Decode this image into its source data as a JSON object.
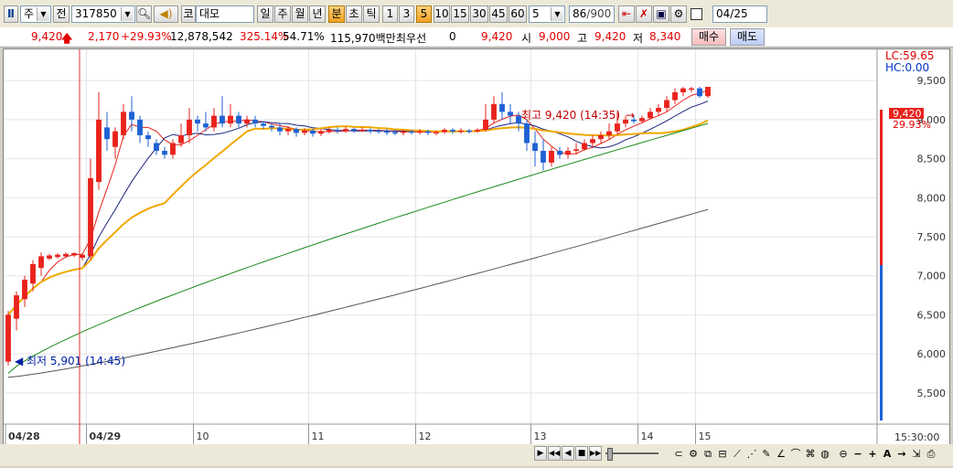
{
  "toolbar": {
    "market_label": "주",
    "prefix_label": "전",
    "code_value": "317850",
    "market_tag": "코",
    "stock_name": "대모",
    "period_buttons": [
      "일",
      "주",
      "월",
      "년",
      "분",
      "초",
      "틱"
    ],
    "active_period": "분",
    "interval_buttons": [
      "1",
      "3",
      "5",
      "10",
      "15",
      "30",
      "45",
      "60"
    ],
    "active_interval": "5",
    "interval_select": "5",
    "count_value": "86",
    "count_total": "/900",
    "date_value": "04/25"
  },
  "quote": {
    "price": "9,420",
    "change": "2,170",
    "change_pct": "+29.93%",
    "volume": "12,878,542",
    "volume_ratio": "325.14%",
    "turnover_ratio": "54.71%",
    "amount": "115,970백만",
    "priority_label": "최우선",
    "priority_qty": "0",
    "priority_price": "9,420",
    "open_label": "시",
    "open_value": "9,000",
    "high_label": "고",
    "high_value": "9,420",
    "low_label": "저",
    "low_value": "8,340",
    "buy_label": "매수",
    "sell_label": "매도"
  },
  "chart": {
    "lc_label": "LC:59.65",
    "hc_label": "HC:0.00",
    "current_price_tag": "9,420",
    "current_pct_tag": "29.93%",
    "high_annotation": "최고 9,420 (14:35)",
    "low_annotation": "최저 5,901 (14:45)",
    "time_label": "15:30:00",
    "date_labels": [
      "04/28",
      "04/29",
      "10",
      "11",
      "12",
      "13",
      "14",
      "15"
    ],
    "colors": {
      "up": "#e8231c",
      "down": "#1f62d4",
      "ma5": "#e8231c",
      "ma10": "#1a237e",
      "ma20": "#f0a800",
      "ma60": "#1a8a1a",
      "ma120": "#555555"
    }
  },
  "chart_data": {
    "type": "candlestick",
    "ylim": [
      5100,
      9900
    ],
    "y_ticks": [
      "9,500",
      "9,000",
      "8,500",
      "8,000",
      "7,500",
      "7,000",
      "6,500",
      "6,000",
      "5,500"
    ],
    "y_tick_values": [
      9500,
      9000,
      8500,
      8000,
      7500,
      7000,
      6500,
      6000,
      5500
    ],
    "x_labels": [
      "04/28",
      "04/29",
      "10",
      "11",
      "12",
      "13",
      "14",
      "15"
    ],
    "candles": [
      [
        5900,
        6500,
        5850,
        6550
      ],
      [
        6450,
        6750,
        6300,
        6800
      ],
      [
        6700,
        6950,
        6600,
        7000
      ],
      [
        6900,
        7150,
        6800,
        7200
      ],
      [
        7100,
        7250,
        7000,
        7300
      ],
      [
        7220,
        7260,
        7200,
        7280
      ],
      [
        7240,
        7270,
        7220,
        7290
      ],
      [
        7250,
        7280,
        7230,
        7300
      ],
      [
        7260,
        7290,
        7240,
        7300
      ],
      [
        7230,
        7270,
        7200,
        7290
      ],
      [
        7250,
        8250,
        7200,
        8500
      ],
      [
        8200,
        9000,
        8100,
        9350
      ],
      [
        8900,
        8750,
        8600,
        9100
      ],
      [
        8650,
        8850,
        8500,
        8900
      ],
      [
        8800,
        9100,
        8750,
        9200
      ],
      [
        9100,
        9000,
        8850,
        9300
      ],
      [
        9000,
        8800,
        8700,
        9050
      ],
      [
        8800,
        8750,
        8650,
        8850
      ],
      [
        8700,
        8600,
        8550,
        8750
      ],
      [
        8600,
        8550,
        8500,
        8650
      ],
      [
        8550,
        8700,
        8500,
        8750
      ],
      [
        8700,
        8800,
        8650,
        8950
      ],
      [
        8800,
        9000,
        8700,
        9150
      ],
      [
        9000,
        8950,
        8850,
        9050
      ],
      [
        8950,
        8900,
        8850,
        9100
      ],
      [
        8900,
        9050,
        8850,
        9150
      ],
      [
        9050,
        8950,
        8900,
        9300
      ],
      [
        8950,
        9050,
        8900,
        9200
      ],
      [
        9050,
        8950,
        8900,
        9100
      ],
      [
        8950,
        9000,
        8900,
        9050
      ],
      [
        9000,
        8950,
        8900,
        9050
      ],
      [
        8950,
        8920,
        8880,
        8980
      ],
      [
        8920,
        8900,
        8850,
        8950
      ],
      [
        8900,
        8850,
        8800,
        8950
      ],
      [
        8850,
        8880,
        8800,
        8920
      ],
      [
        8880,
        8830,
        8780,
        8900
      ],
      [
        8830,
        8860,
        8800,
        8890
      ],
      [
        8860,
        8820,
        8780,
        8880
      ],
      [
        8820,
        8850,
        8790,
        8880
      ],
      [
        8850,
        8870,
        8820,
        8900
      ],
      [
        8870,
        8850,
        8820,
        8900
      ],
      [
        8850,
        8880,
        8830,
        8910
      ],
      [
        8880,
        8860,
        8830,
        8900
      ],
      [
        8860,
        8870,
        8840,
        8900
      ],
      [
        8870,
        8860,
        8820,
        8890
      ],
      [
        8860,
        8850,
        8820,
        8880
      ],
      [
        8850,
        8840,
        8800,
        8880
      ],
      [
        8840,
        8830,
        8800,
        8870
      ],
      [
        8830,
        8850,
        8800,
        8870
      ],
      [
        8850,
        8840,
        8810,
        8870
      ],
      [
        8840,
        8850,
        8810,
        8880
      ],
      [
        8850,
        8830,
        8800,
        8870
      ],
      [
        8830,
        8840,
        8800,
        8860
      ],
      [
        8840,
        8870,
        8820,
        8890
      ],
      [
        8870,
        8850,
        8820,
        8890
      ],
      [
        8850,
        8860,
        8820,
        8890
      ],
      [
        8860,
        8850,
        8820,
        8880
      ],
      [
        8850,
        8870,
        8830,
        8890
      ],
      [
        8870,
        9000,
        8850,
        9200
      ],
      [
        9000,
        9200,
        8950,
        9300
      ],
      [
        9200,
        9100,
        9000,
        9350
      ],
      [
        9100,
        9050,
        8950,
        9200
      ],
      [
        9050,
        8950,
        8850,
        9100
      ],
      [
        8950,
        8700,
        8600,
        9000
      ],
      [
        8700,
        8600,
        8400,
        8850
      ],
      [
        8600,
        8450,
        8350,
        8750
      ],
      [
        8450,
        8600,
        8400,
        8650
      ],
      [
        8600,
        8550,
        8500,
        8650
      ],
      [
        8550,
        8600,
        8500,
        8650
      ],
      [
        8600,
        8620,
        8550,
        8700
      ],
      [
        8620,
        8700,
        8600,
        8750
      ],
      [
        8700,
        8750,
        8650,
        8800
      ],
      [
        8750,
        8800,
        8700,
        8850
      ],
      [
        8800,
        8850,
        8750,
        8950
      ],
      [
        8850,
        8950,
        8800,
        9100
      ],
      [
        8950,
        9000,
        8900,
        9050
      ],
      [
        9000,
        8980,
        8950,
        9050
      ],
      [
        8980,
        9020,
        8950,
        9050
      ],
      [
        9020,
        9100,
        9000,
        9150
      ],
      [
        9100,
        9150,
        9050,
        9200
      ],
      [
        9150,
        9250,
        9100,
        9300
      ],
      [
        9250,
        9350,
        9200,
        9400
      ],
      [
        9350,
        9400,
        9300,
        9420
      ],
      [
        9400,
        9400,
        9350,
        9420
      ],
      [
        9400,
        9300,
        9280,
        9420
      ],
      [
        9300,
        9420,
        9280,
        9420
      ]
    ]
  },
  "bottom": {
    "scroll_buttons": [
      "▶",
      "◀◀",
      "◀",
      "■",
      "▶▶"
    ]
  }
}
